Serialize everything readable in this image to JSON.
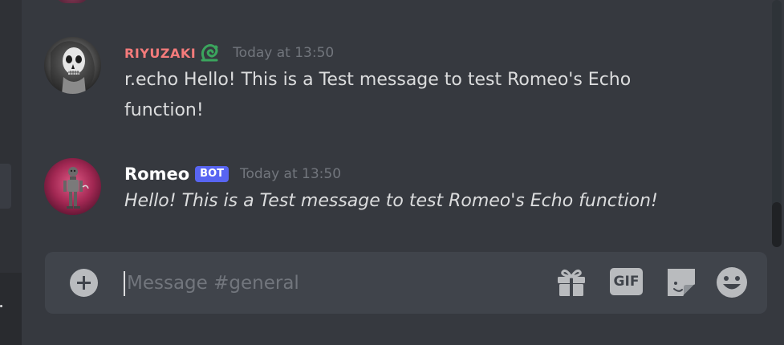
{
  "colors": {
    "background": "#36393f",
    "input_background": "#40444b",
    "username_riyuzaki": "#f47b7b",
    "bot_tag": "#5865f2",
    "timestamp": "#72767d",
    "text": "#dcddde",
    "role_icon": "#3ba55d"
  },
  "messages": [
    {
      "username": "RIYUZAKI",
      "role_icon": "snake-icon",
      "timestamp": "Today at 13:50",
      "content": "r.echo Hello! This is a Test message to test Romeo's Echo function!"
    },
    {
      "username": "Romeo",
      "tag": "BOT",
      "timestamp": "Today at 13:50",
      "content": "Hello! This is a Test message to test Romeo's Echo function!"
    }
  ],
  "composer": {
    "placeholder": "Message #general",
    "gif_label": "GIF",
    "icons": [
      "plus-circle-icon",
      "gift-icon",
      "gif-icon",
      "sticker-icon",
      "emoji-icon"
    ]
  }
}
